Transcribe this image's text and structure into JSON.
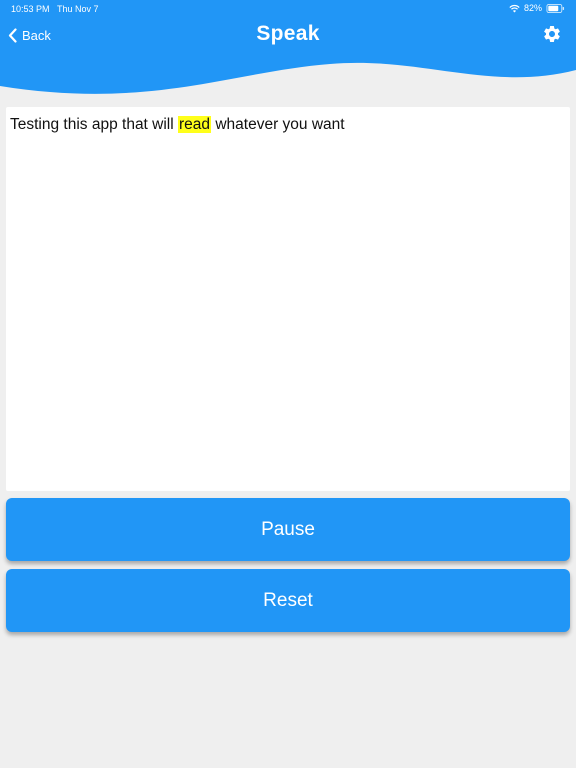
{
  "status_bar": {
    "time": "10:53 PM",
    "date": "Thu Nov 7",
    "battery_percent": "82%",
    "battery_level": 0.82
  },
  "header": {
    "back_label": "Back",
    "title": "Speak",
    "icons": {
      "back": "chevron-left-icon",
      "settings": "gear-icon",
      "wifi": "wifi-icon",
      "battery": "battery-icon"
    }
  },
  "text_area": {
    "before": "Testing this app that will ",
    "highlighted": "read",
    "after": " whatever you want"
  },
  "buttons": {
    "pause_label": "Pause",
    "reset_label": "Reset"
  },
  "colors": {
    "accent": "#2196f6",
    "highlight": "#ffff1a",
    "background": "#efefef"
  }
}
